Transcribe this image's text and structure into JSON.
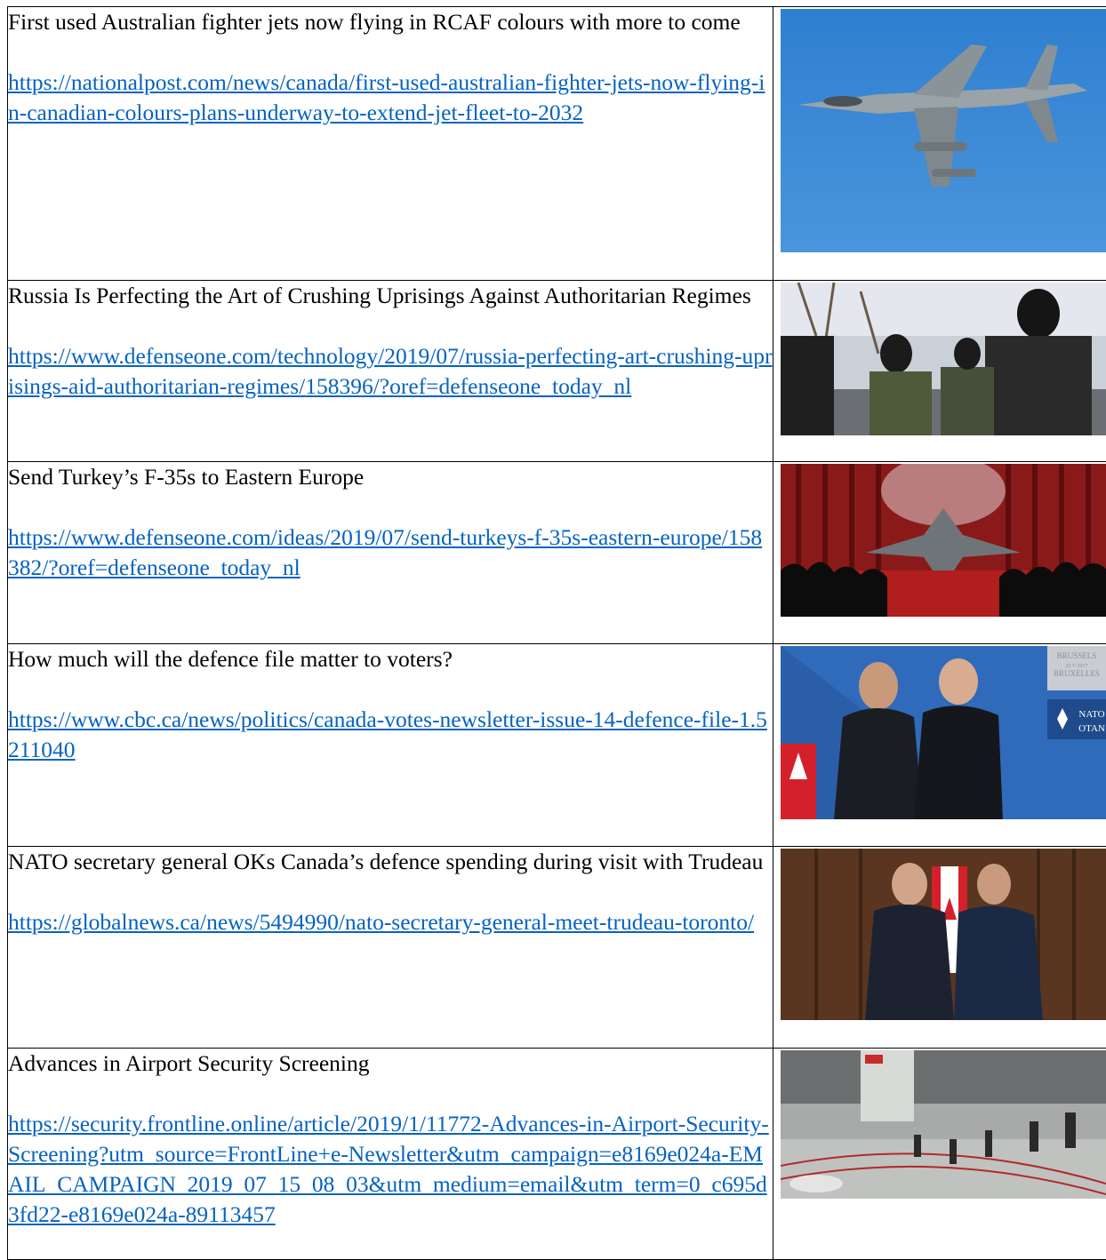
{
  "articles": [
    {
      "title": "First used Australian fighter jets now flying in RCAF colours with more to come",
      "url": "https://nationalpost.com/news/canada/first-used-australian-fighter-jets-now-flying-in-canadian-colours-plans-underway-to-extend-jet-fleet-to-2032",
      "image": "fighter-jet-photo"
    },
    {
      "title": "Russia Is Perfecting the Art of Crushing Uprisings Against Authoritarian Regimes",
      "url": "https://www.defenseone.com/technology/2019/07/russia-perfecting-art-crushing-uprisings-aid-authoritarian-regimes/158396/?oref=defenseone_today_nl",
      "image": "masked-soldiers-photo"
    },
    {
      "title": "Send Turkey’s F-35s to Eastern Europe",
      "url": "https://www.defenseone.com/ideas/2019/07/send-turkeys-f-35s-eastern-europe/158382/?oref=defenseone_today_nl",
      "image": "f35-unveiling-photo"
    },
    {
      "title": "How much will the defence file matter to voters?",
      "url": "https://www.cbc.ca/news/politics/canada-votes-newsletter-issue-14-defence-file-1.5211040",
      "image": "trudeau-stoltenberg-nato-photo",
      "image_text": [
        "BRUSSELS",
        "25 V 2017",
        "BRUXELLES",
        "NATO",
        "OTAN"
      ]
    },
    {
      "title": "NATO secretary general OKs Canada’s defence spending during visit with Trudeau",
      "url": "https://globalnews.ca/news/5494990/nato-secretary-general-meet-trudeau-toronto/",
      "image": "handshake-flag-photo"
    },
    {
      "title": "Advances in Airport Security Screening",
      "url": "https://security.frontline.online/article/2019/1/11772-Advances-in-Airport-Security-Screening?utm_source=FrontLine+e-Newsletter&utm_campaign=e8169e024a-EMAIL_CAMPAIGN_2019_07_15_08_03&utm_medium=email&utm_term=0_c695d3fd22-e8169e024a-89113457",
      "image": "airport-security-photo"
    }
  ],
  "colors": {
    "link": "#0563c1",
    "text": "#000000",
    "border": "#000000"
  }
}
